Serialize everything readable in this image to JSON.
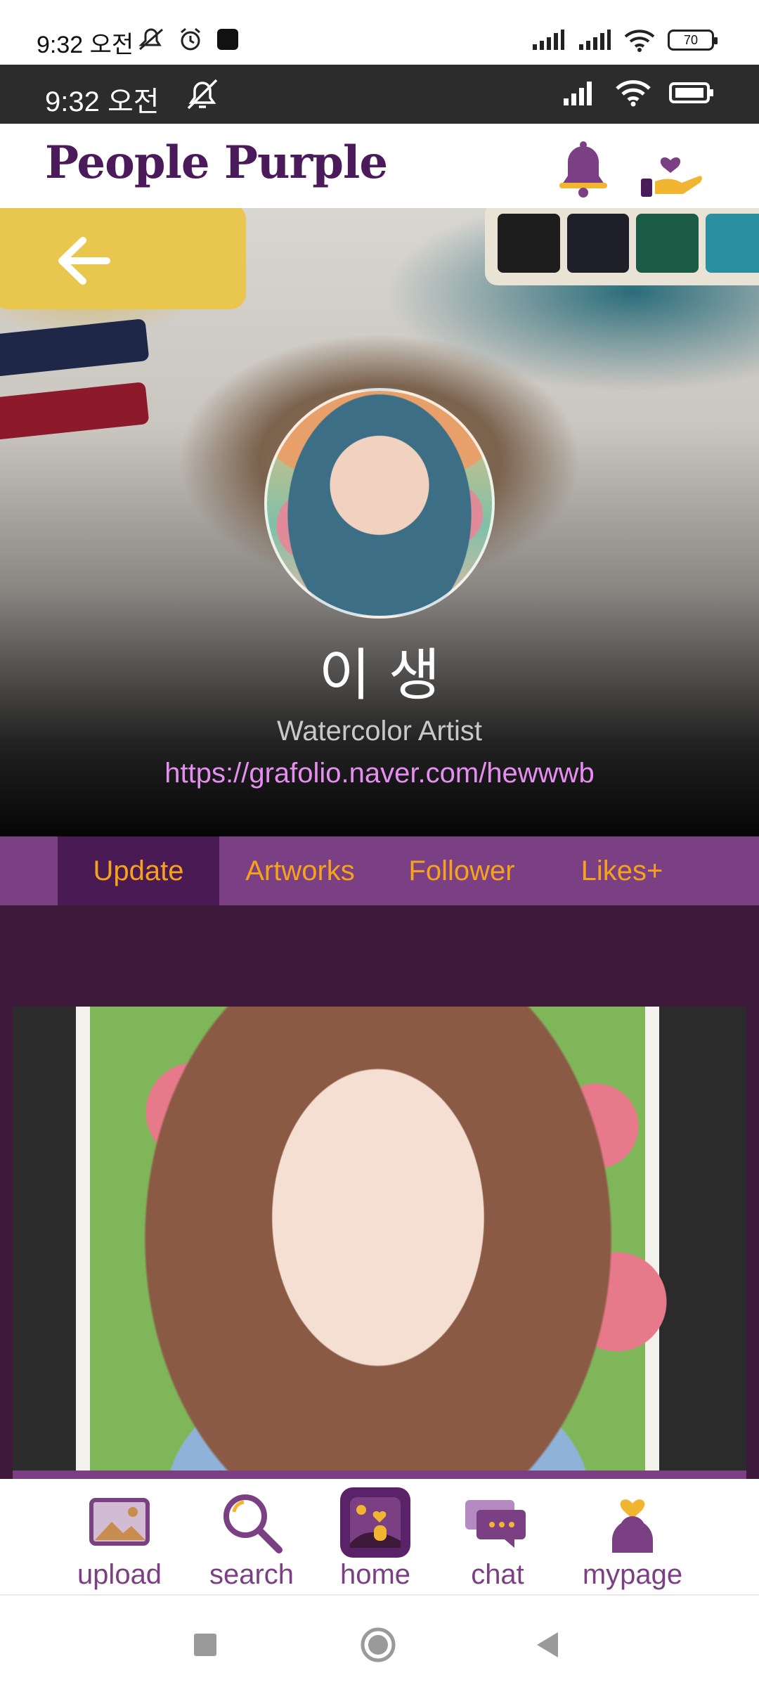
{
  "device_status": {
    "time": "9:32 오전",
    "battery": "70"
  },
  "app_status": {
    "time": "9:32 오전"
  },
  "header": {
    "brand": "People Purple",
    "bell_icon": "bell-icon",
    "donate_icon": "hand-heart-icon"
  },
  "profile": {
    "name": "이 생",
    "role": "Watercolor Artist",
    "link": "https://grafolio.naver.com/hewwwb"
  },
  "tabs": [
    {
      "label": "Update",
      "active": true
    },
    {
      "label": "Artworks",
      "active": false
    },
    {
      "label": "Follower",
      "active": false
    },
    {
      "label": "Likes+",
      "active": false
    }
  ],
  "bottom_nav": [
    {
      "label": "upload",
      "icon": "image-icon"
    },
    {
      "label": "search",
      "icon": "search-icon"
    },
    {
      "label": "home",
      "icon": "home-icon",
      "active": true
    },
    {
      "label": "chat",
      "icon": "chat-icon"
    },
    {
      "label": "mypage",
      "icon": "user-heart-icon"
    }
  ],
  "colors": {
    "brand": "#4b1a5a",
    "accent_purple": "#7b3f83",
    "tab_active": "#4a1a55",
    "tab_text": "#f5a21c",
    "link": "#e58ef0",
    "feed_bg": "#3e1a3a"
  }
}
